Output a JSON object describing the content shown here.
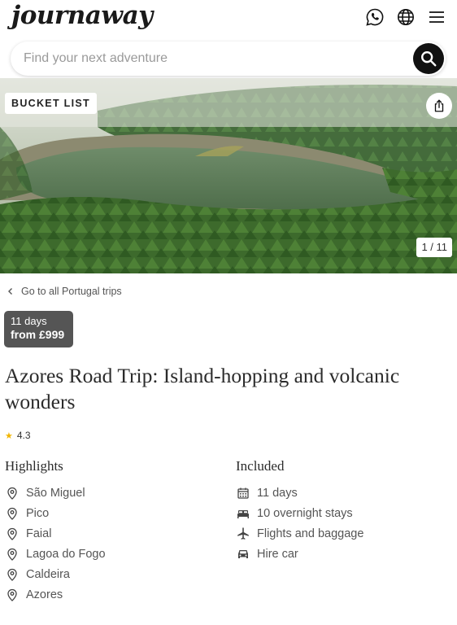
{
  "header": {
    "logo": "journaway",
    "icons": [
      "whatsapp-icon",
      "globe-icon",
      "menu-icon"
    ]
  },
  "search": {
    "placeholder": "Find your next adventure",
    "button_icon": "search-icon"
  },
  "hero": {
    "badge": "BUCKET LIST",
    "counter": "1 / 11",
    "current_image": 1,
    "total_images": 11
  },
  "back_link": "Go to all Portugal trips",
  "price": {
    "days": "11 days",
    "amount": "from £999"
  },
  "title": "Azores Road Trip: Island-hopping and volcanic wonders",
  "rating": "4.3",
  "highlights": {
    "heading": "Highlights",
    "items": [
      "São Miguel",
      "Pico",
      "Faial",
      "Lagoa do Fogo",
      "Caldeira",
      "Azores"
    ]
  },
  "included": {
    "heading": "Included",
    "items": [
      {
        "label": "11 days",
        "icon": "calendar-icon"
      },
      {
        "label": "10 overnight stays",
        "icon": "bed-icon"
      },
      {
        "label": "Flights and baggage",
        "icon": "plane-icon"
      },
      {
        "label": "Hire car",
        "icon": "car-icon"
      }
    ]
  },
  "colors": {
    "price_badge_bg": "#555555",
    "star": "#f2b600",
    "search_button": "#111111"
  }
}
